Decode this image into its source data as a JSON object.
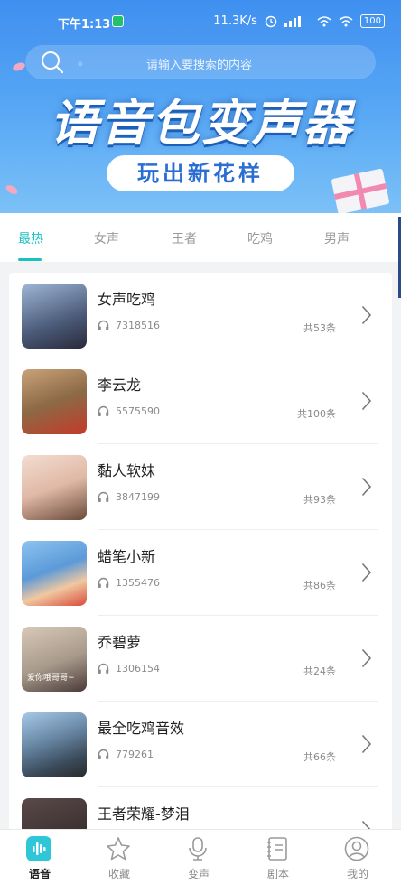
{
  "status_bar": {
    "time": "下午1:13",
    "speed": "11.3K/s",
    "battery": "100"
  },
  "search": {
    "placeholder": "请输入要搜索的内容"
  },
  "banner": {
    "title": "语音包变声器",
    "subtitle": "玩出新花样"
  },
  "tabs": [
    {
      "label": "最热",
      "active": true
    },
    {
      "label": "女声",
      "active": false
    },
    {
      "label": "王者",
      "active": false
    },
    {
      "label": "吃鸡",
      "active": false
    },
    {
      "label": "男声",
      "active": false
    }
  ],
  "items": [
    {
      "name": "女声吃鸡",
      "plays": "7318516",
      "count": "共53条",
      "thumb_color": "#6b7fa8"
    },
    {
      "name": "李云龙",
      "plays": "5575590",
      "count": "共100条",
      "thumb_color": "#8c6a45"
    },
    {
      "name": "黏人软妹",
      "plays": "3847199",
      "count": "共93条",
      "thumb_color": "#e8c3b4"
    },
    {
      "name": "蜡笔小新",
      "plays": "1355476",
      "count": "共86条",
      "thumb_color": "#5c9ad8"
    },
    {
      "name": "乔碧萝",
      "plays": "1306154",
      "count": "共24条",
      "thumb_color": "#a89a8a",
      "thumb_caption": "爱你哦哥哥~"
    },
    {
      "name": "最全吃鸡音效",
      "plays": "779261",
      "count": "共66条",
      "thumb_color": "#4a5a6a"
    },
    {
      "name": "王者荣耀-梦泪",
      "plays": "",
      "count": "",
      "thumb_color": "#3a3030"
    }
  ],
  "bottom_nav": [
    {
      "label": "语音",
      "icon": "voice-icon",
      "active": true
    },
    {
      "label": "收藏",
      "icon": "star-icon",
      "active": false
    },
    {
      "label": "变声",
      "icon": "microphone-icon",
      "active": false
    },
    {
      "label": "剧本",
      "icon": "script-icon",
      "active": false
    },
    {
      "label": "我的",
      "icon": "profile-icon",
      "active": false
    }
  ],
  "colors": {
    "accent": "#19c2c2",
    "banner": "#3f8ff0"
  }
}
